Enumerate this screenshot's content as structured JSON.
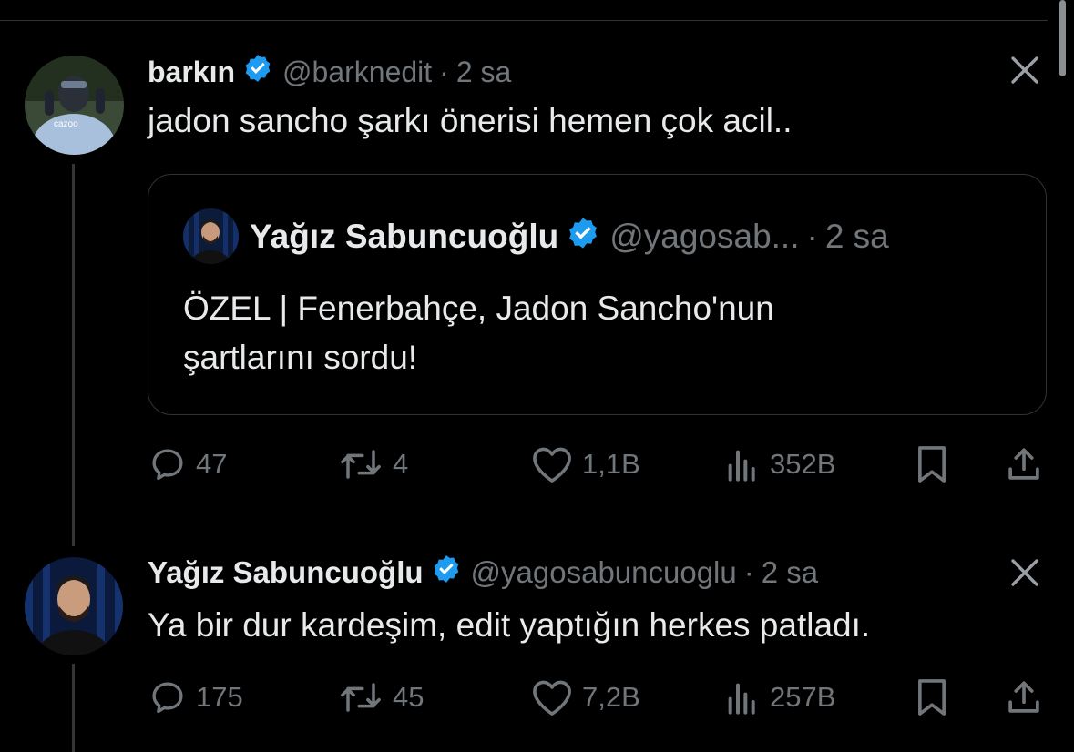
{
  "colors": {
    "background": "#000000",
    "text": "#e7e9ea",
    "muted": "#71767b",
    "verified": "#1d9bf0",
    "border": "#2f3336"
  },
  "tweet1": {
    "name": "barkın",
    "handle": "@barknedit",
    "separator": "·",
    "time": "2 sa",
    "text": "jadon sancho şarkı önerisi hemen çok acil..",
    "verified_icon": "verified-badge-icon",
    "quote": {
      "name": "Yağız Sabuncuoğlu",
      "handle": "@yagosab...",
      "separator": "·",
      "time": "2 sa",
      "text_line1": "ÖZEL | Fenerbahçe, Jadon Sancho'nun",
      "text_line2": "şartlarını sordu!"
    },
    "actions": {
      "replies": "47",
      "retweets": "4",
      "likes": "1,1B",
      "views": "352B"
    }
  },
  "tweet2": {
    "name": "Yağız Sabuncuoğlu",
    "handle": "@yagosabuncuoglu",
    "separator": "·",
    "time": "2 sa",
    "text": "Ya bir dur kardeşim, edit yaptığın herkes patladı.",
    "actions": {
      "replies": "175",
      "retweets": "45",
      "likes": "7,2B",
      "views": "257B"
    }
  },
  "icons": [
    "reply-icon",
    "retweet-icon",
    "like-icon",
    "views-icon",
    "bookmark-icon",
    "share-icon",
    "close-icon",
    "verified-badge-icon"
  ]
}
